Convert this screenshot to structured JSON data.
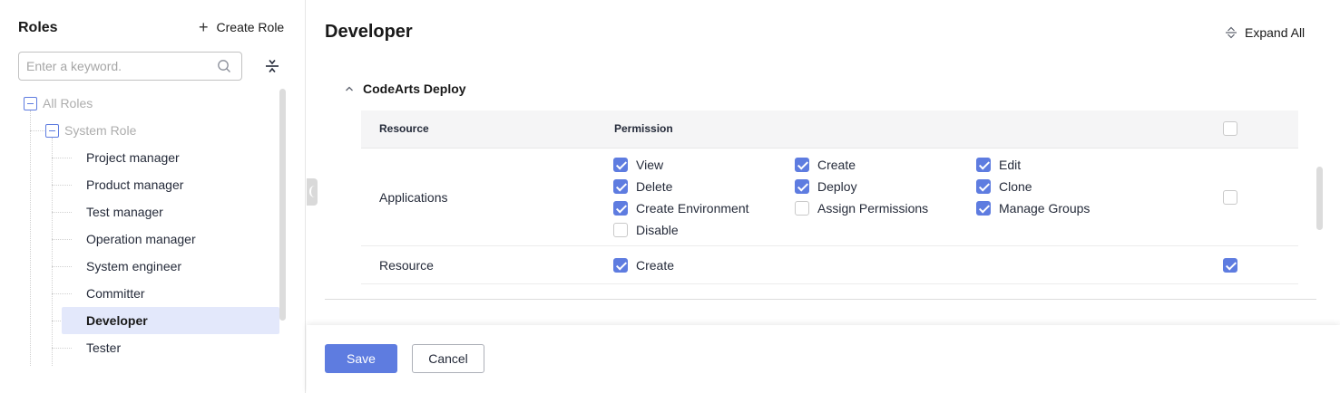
{
  "sidebar": {
    "title": "Roles",
    "create_role_label": "Create Role",
    "create_icon": "plus-icon",
    "search": {
      "placeholder": "Enter a keyword.",
      "value": "",
      "icon": "search-icon"
    },
    "collapse_icon": "collapse-all-icon",
    "tree": {
      "root": "All Roles",
      "group": "System Role",
      "roles": [
        "Project manager",
        "Product manager",
        "Test manager",
        "Operation manager",
        "System engineer",
        "Committer",
        "Developer",
        "Tester"
      ],
      "selected": "Developer"
    }
  },
  "main": {
    "title": "Developer",
    "expand_all_label": "Expand All",
    "expand_icon": "expand-icon",
    "section": {
      "name": "CodeArts Deploy",
      "expanded": true,
      "columns": {
        "resource": "Resource",
        "permission": "Permission"
      },
      "header_checked": false,
      "rows": [
        {
          "resource": "Applications",
          "row_checked": false,
          "permissions": [
            {
              "label": "View",
              "checked": true
            },
            {
              "label": "Create",
              "checked": true
            },
            {
              "label": "Edit",
              "checked": true
            },
            {
              "label": "Delete",
              "checked": true
            },
            {
              "label": "Deploy",
              "checked": true
            },
            {
              "label": "Clone",
              "checked": true
            },
            {
              "label": "Create Environment",
              "checked": true
            },
            {
              "label": "Assign Permissions",
              "checked": false
            },
            {
              "label": "Manage Groups",
              "checked": true
            },
            {
              "label": "Disable",
              "checked": false
            }
          ]
        },
        {
          "resource": "Resource",
          "row_checked": true,
          "permissions": [
            {
              "label": "Create",
              "checked": true
            }
          ]
        }
      ]
    }
  },
  "footer": {
    "save_label": "Save",
    "cancel_label": "Cancel"
  },
  "colors": {
    "accent": "#5e7ce0",
    "selected_bg": "#e3e8fb",
    "header_bg": "#f5f5f6"
  }
}
